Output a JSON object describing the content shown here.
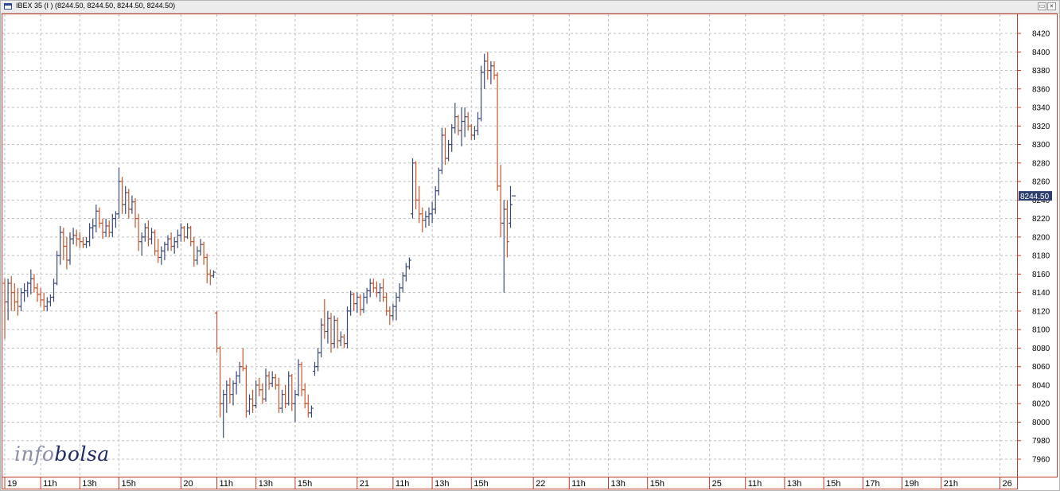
{
  "window": {
    "title": "IBEX 35 (I ) (8244.50, 8244.50, 8244.50, 8244.50)",
    "restore_symbol": "▭",
    "close_symbol": "×"
  },
  "logo": {
    "part1": "info",
    "part2": "bolsa"
  },
  "colors": {
    "up": "#3b4a7a",
    "down": "#c8552c",
    "grid": "#bfbfbf",
    "frame": "#c23b2a",
    "last_price_bg": "#2e3f6e",
    "last_price_text": "#ffffff"
  },
  "chart_data": {
    "type": "bar",
    "style": "OHLC",
    "title": "IBEX 35 (I )",
    "last_ohlc": [
      8244.5,
      8244.5,
      8244.5,
      8244.5
    ],
    "ylim": [
      7950,
      8430
    ],
    "y_ticks": [
      7960,
      7980,
      8000,
      8020,
      8040,
      8060,
      8080,
      8100,
      8120,
      8140,
      8160,
      8180,
      8200,
      8220,
      8240,
      8260,
      8280,
      8300,
      8320,
      8340,
      8360,
      8380,
      8400,
      8420
    ],
    "last_price_label": "8244.50",
    "last_price": 8244.5,
    "grid": true,
    "x_tick_labels": [
      {
        "label": "19",
        "bar": 0
      },
      {
        "label": "11h",
        "bar": 11
      },
      {
        "label": "13h",
        "bar": 23
      },
      {
        "label": "15h",
        "bar": 35
      },
      {
        "label": "20",
        "bar": 54
      },
      {
        "label": "11h",
        "bar": 65
      },
      {
        "label": "13h",
        "bar": 77
      },
      {
        "label": "15h",
        "bar": 89
      },
      {
        "label": "21",
        "bar": 108
      },
      {
        "label": "11h",
        "bar": 119
      },
      {
        "label": "13h",
        "bar": 131
      },
      {
        "label": "15h",
        "bar": 143
      },
      {
        "label": "22",
        "bar": 162
      },
      {
        "label": "11h",
        "bar": 173
      },
      {
        "label": "13h",
        "bar": 185
      },
      {
        "label": "15h",
        "bar": 197
      },
      {
        "label": "25",
        "bar": 216
      },
      {
        "label": "11h",
        "bar": 227
      },
      {
        "label": "13h",
        "bar": 239
      },
      {
        "label": "15h",
        "bar": 251
      },
      {
        "label": "17h",
        "bar": 263
      },
      {
        "label": "19h",
        "bar": 275
      },
      {
        "label": "21h",
        "bar": 287
      },
      {
        "label": "26",
        "bar": 305
      }
    ],
    "bars": [
      [
        8150,
        8155,
        8090,
        8130
      ],
      [
        8130,
        8155,
        8110,
        8150
      ],
      [
        8150,
        8158,
        8120,
        8140
      ],
      [
        8140,
        8150,
        8120,
        8130
      ],
      [
        8130,
        8145,
        8115,
        8125
      ],
      [
        8125,
        8145,
        8120,
        8140
      ],
      [
        8140,
        8150,
        8130,
        8142
      ],
      [
        8142,
        8152,
        8135,
        8150
      ],
      [
        8150,
        8165,
        8138,
        8155
      ],
      [
        8155,
        8160,
        8140,
        8145
      ],
      [
        8145,
        8150,
        8130,
        8138
      ],
      [
        8138,
        8145,
        8125,
        8132
      ],
      [
        8132,
        8140,
        8120,
        8125
      ],
      [
        8125,
        8135,
        8120,
        8130
      ],
      [
        8130,
        8138,
        8125,
        8135
      ],
      [
        8135,
        8155,
        8130,
        8150
      ],
      [
        8150,
        8185,
        8148,
        8180
      ],
      [
        8180,
        8212,
        8170,
        8205
      ],
      [
        8205,
        8210,
        8175,
        8190
      ],
      [
        8190,
        8200,
        8165,
        8175
      ],
      [
        8175,
        8205,
        8170,
        8198
      ],
      [
        8198,
        8210,
        8192,
        8202
      ],
      [
        8202,
        8208,
        8190,
        8198
      ],
      [
        8198,
        8205,
        8188,
        8195
      ],
      [
        8195,
        8200,
        8188,
        8192
      ],
      [
        8192,
        8200,
        8188,
        8195
      ],
      [
        8195,
        8215,
        8190,
        8210
      ],
      [
        8210,
        8220,
        8198,
        8212
      ],
      [
        8212,
        8235,
        8205,
        8228
      ],
      [
        8228,
        8232,
        8210,
        8215
      ],
      [
        8215,
        8220,
        8198,
        8205
      ],
      [
        8205,
        8220,
        8200,
        8212
      ],
      [
        8212,
        8218,
        8200,
        8205
      ],
      [
        8205,
        8225,
        8200,
        8220
      ],
      [
        8220,
        8228,
        8210,
        8225
      ],
      [
        8225,
        8275,
        8220,
        8260
      ],
      [
        8260,
        8265,
        8225,
        8235
      ],
      [
        8235,
        8255,
        8225,
        8248
      ],
      [
        8248,
        8252,
        8220,
        8230
      ],
      [
        8230,
        8245,
        8225,
        8238
      ],
      [
        8238,
        8242,
        8210,
        8220
      ],
      [
        8220,
        8225,
        8185,
        8195
      ],
      [
        8195,
        8205,
        8180,
        8200
      ],
      [
        8200,
        8215,
        8195,
        8210
      ],
      [
        8210,
        8218,
        8190,
        8198
      ],
      [
        8198,
        8210,
        8192,
        8205
      ],
      [
        8205,
        8208,
        8180,
        8185
      ],
      [
        8185,
        8198,
        8172,
        8178
      ],
      [
        8178,
        8190,
        8170,
        8185
      ],
      [
        8185,
        8195,
        8175,
        8192
      ],
      [
        8192,
        8202,
        8185,
        8198
      ],
      [
        8198,
        8205,
        8185,
        8190
      ],
      [
        8190,
        8200,
        8182,
        8195
      ],
      [
        8195,
        8208,
        8188,
        8202
      ],
      [
        8202,
        8215,
        8195,
        8210
      ],
      [
        8210,
        8212,
        8195,
        8200
      ],
      [
        8200,
        8215,
        8198,
        8210
      ],
      [
        8210,
        8212,
        8190,
        8195
      ],
      [
        8195,
        8200,
        8168,
        8175
      ],
      [
        8175,
        8190,
        8170,
        8185
      ],
      [
        8185,
        8198,
        8180,
        8192
      ],
      [
        8192,
        8195,
        8170,
        8178
      ],
      [
        8178,
        8182,
        8150,
        8160
      ],
      [
        8160,
        8165,
        8148,
        8158
      ],
      [
        8158,
        8164,
        8156,
        8162
      ],
      [
        8118,
        8120,
        8075,
        8080
      ],
      [
        8080,
        8082,
        8005,
        8020
      ],
      [
        8020,
        8035,
        7983,
        8030
      ],
      [
        8030,
        8045,
        8010,
        8040
      ],
      [
        8040,
        8048,
        8020,
        8030
      ],
      [
        8030,
        8045,
        8018,
        8042
      ],
      [
        8042,
        8055,
        8030,
        8050
      ],
      [
        8050,
        8065,
        8042,
        8060
      ],
      [
        8060,
        8080,
        8055,
        8058
      ],
      [
        8058,
        8062,
        8005,
        8012
      ],
      [
        8012,
        8030,
        8008,
        8025
      ],
      [
        8025,
        8035,
        8010,
        8018
      ],
      [
        8018,
        8045,
        8015,
        8040
      ],
      [
        8040,
        8048,
        8028,
        8035
      ],
      [
        8035,
        8042,
        8020,
        8025
      ],
      [
        8025,
        8058,
        8022,
        8050
      ],
      [
        8050,
        8055,
        8035,
        8042
      ],
      [
        8042,
        8055,
        8038,
        8048
      ],
      [
        8048,
        8052,
        8035,
        8040
      ],
      [
        8040,
        8048,
        8010,
        8015
      ],
      [
        8015,
        8035,
        8010,
        8030
      ],
      [
        8030,
        8040,
        8015,
        8020
      ],
      [
        8020,
        8055,
        8018,
        8050
      ],
      [
        8050,
        8052,
        8012,
        8020
      ],
      [
        8020,
        8035,
        8000,
        8030
      ],
      [
        8030,
        8068,
        8028,
        8062
      ],
      [
        8062,
        8065,
        8028,
        8035
      ],
      [
        8035,
        8042,
        8015,
        8020
      ],
      [
        8020,
        8030,
        8005,
        8010
      ],
      [
        8010,
        8018,
        8005,
        8015
      ],
      [
        8055,
        8065,
        8050,
        8060
      ],
      [
        8060,
        8080,
        8055,
        8075
      ],
      [
        8075,
        8112,
        8070,
        8105
      ],
      [
        8105,
        8133,
        8090,
        8098
      ],
      [
        8098,
        8120,
        8085,
        8112
      ],
      [
        8112,
        8118,
        8075,
        8085
      ],
      [
        8085,
        8115,
        8080,
        8110
      ],
      [
        8110,
        8113,
        8080,
        8088
      ],
      [
        8088,
        8098,
        8082,
        8092
      ],
      [
        8092,
        8095,
        8080,
        8085
      ],
      [
        8085,
        8125,
        8080,
        8120
      ],
      [
        8120,
        8142,
        8115,
        8138
      ],
      [
        8138,
        8140,
        8120,
        8128
      ],
      [
        8128,
        8140,
        8118,
        8135
      ],
      [
        8135,
        8138,
        8115,
        8122
      ],
      [
        8122,
        8140,
        8118,
        8135
      ],
      [
        8135,
        8145,
        8128,
        8142
      ],
      [
        8142,
        8155,
        8135,
        8150
      ],
      [
        8150,
        8155,
        8140,
        8145
      ],
      [
        8145,
        8152,
        8135,
        8140
      ],
      [
        8140,
        8150,
        8130,
        8145
      ],
      [
        8145,
        8155,
        8130,
        8135
      ],
      [
        8135,
        8140,
        8115,
        8120
      ],
      [
        8120,
        8125,
        8105,
        8115
      ],
      [
        8115,
        8128,
        8110,
        8125
      ],
      [
        8125,
        8140,
        8110,
        8135
      ],
      [
        8135,
        8150,
        8130,
        8145
      ],
      [
        8145,
        8162,
        8140,
        8158
      ],
      [
        8158,
        8172,
        8152,
        8168
      ],
      [
        8168,
        8178,
        8165,
        8175
      ],
      [
        8225,
        8285,
        8220,
        8280
      ],
      [
        8280,
        8282,
        8230,
        8240
      ],
      [
        8240,
        8255,
        8215,
        8225
      ],
      [
        8225,
        8232,
        8205,
        8218
      ],
      [
        8218,
        8228,
        8210,
        8222
      ],
      [
        8222,
        8232,
        8212,
        8225
      ],
      [
        8225,
        8238,
        8215,
        8230
      ],
      [
        8230,
        8255,
        8225,
        8250
      ],
      [
        8250,
        8275,
        8245,
        8272
      ],
      [
        8272,
        8318,
        8268,
        8310
      ],
      [
        8310,
        8318,
        8278,
        8285
      ],
      [
        8285,
        8305,
        8282,
        8300
      ],
      [
        8300,
        8322,
        8292,
        8318
      ],
      [
        8318,
        8345,
        8312,
        8330
      ],
      [
        8330,
        8332,
        8310,
        8315
      ],
      [
        8315,
        8340,
        8298,
        8325
      ],
      [
        8325,
        8340,
        8308,
        8330
      ],
      [
        8330,
        8335,
        8315,
        8320
      ],
      [
        8320,
        8322,
        8305,
        8310
      ],
      [
        8310,
        8320,
        8305,
        8315
      ],
      [
        8315,
        8335,
        8310,
        8328
      ],
      [
        8328,
        8385,
        8325,
        8378
      ],
      [
        8378,
        8398,
        8360,
        8390
      ],
      [
        8390,
        8400,
        8370,
        8380
      ],
      [
        8380,
        8390,
        8365,
        8385
      ],
      [
        8385,
        8390,
        8370,
        8375
      ],
      [
        8375,
        8378,
        8250,
        8255
      ],
      [
        8255,
        8278,
        8200,
        8215
      ],
      [
        8215,
        8240,
        8140,
        8230
      ],
      [
        8230,
        8240,
        8178,
        8195
      ],
      [
        8215,
        8255,
        8210,
        8235
      ],
      [
        8244.5,
        8244.5,
        8244.5,
        8244.5
      ]
    ]
  }
}
